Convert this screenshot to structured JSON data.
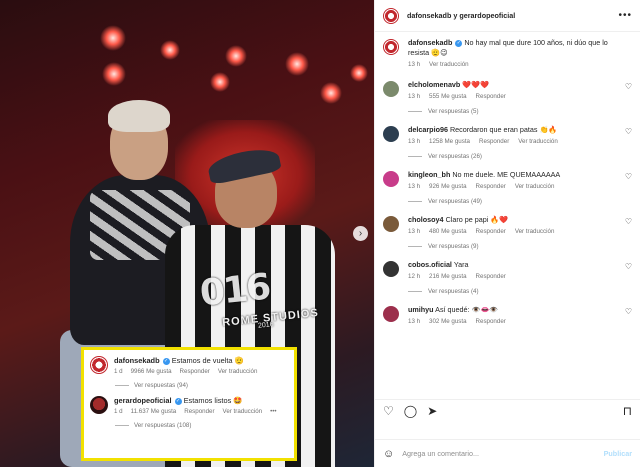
{
  "header": {
    "title": "dafonsekadb y gerardopeoficial",
    "more_icon": "more-horizontal-icon"
  },
  "caption": {
    "username": "dafonsekadb",
    "text": "No hay mal que dure 100 años, ni dúo que lo resista 🫡😉",
    "time": "13 h",
    "translate": "Ver traducción"
  },
  "comments": [
    {
      "username": "elcholomenavb",
      "text": "❤️❤️❤️",
      "time": "13 h",
      "likes": "555 Me gusta",
      "reply": "Responder",
      "translate": "",
      "replies": "Ver respuestas (5)"
    },
    {
      "username": "delcarpio96",
      "text": "Recordaron que eran patas 👏🔥",
      "time": "13 h",
      "likes": "1258 Me gusta",
      "reply": "Responder",
      "translate": "Ver traducción",
      "replies": "Ver respuestas (26)"
    },
    {
      "username": "kingleon_bh",
      "text": "No me duele. ME QUEMAAAAAA",
      "time": "13 h",
      "likes": "926 Me gusta",
      "reply": "Responder",
      "translate": "Ver traducción",
      "replies": "Ver respuestas (49)"
    },
    {
      "username": "cholosoy4",
      "text": "Claro pe papi 🔥❤️",
      "time": "13 h",
      "likes": "480 Me gusta",
      "reply": "Responder",
      "translate": "Ver traducción",
      "replies": "Ver respuestas (9)"
    },
    {
      "username": "cobos.oficial",
      "text": "Yara",
      "time": "12 h",
      "likes": "216 Me gusta",
      "reply": "Responder",
      "translate": "",
      "replies": "Ver respuestas (4)"
    },
    {
      "username": "umihyu",
      "text": "Así quedé: 👁️👄👁️",
      "time": "13 h",
      "likes": "302 Me gusta",
      "reply": "Responder",
      "translate": "",
      "replies": ""
    }
  ],
  "highlight": [
    {
      "username": "dafonsekadb",
      "text": "Estamos de vuelta 🫡",
      "time": "1 d",
      "likes": "9966 Me gusta",
      "reply": "Responder",
      "translate": "Ver traducción",
      "replies": "Ver respuestas (94)"
    },
    {
      "username": "gerardopeoficial",
      "text": "Estamos listos 🤩",
      "time": "1 d",
      "likes": "11.637 Me gusta",
      "reply": "Responder",
      "translate": "Ver traducción",
      "more": "•••",
      "replies": "Ver respuestas (108)"
    }
  ],
  "photo": {
    "shirt_number": "016",
    "shirt_brand": "ROME STUDIOS",
    "shirt_year": "2016"
  },
  "actions": {
    "like_icon": "heart-icon",
    "comment_icon": "comment-icon",
    "share_icon": "send-icon",
    "save_icon": "bookmark-icon"
  },
  "add_comment": {
    "placeholder": "Agrega un comentario...",
    "publish": "Publicar"
  },
  "colors": {
    "highlight_border": "#f2e100",
    "verified": "#3897f0",
    "publish": "#b2dffc"
  }
}
